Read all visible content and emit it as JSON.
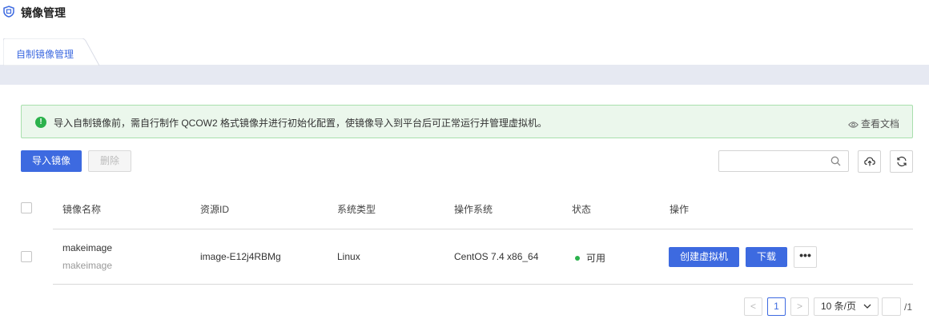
{
  "header": {
    "title": "镜像管理",
    "logo_icon": "shield-icon"
  },
  "tabs": [
    {
      "label": "自制镜像管理",
      "active": true
    }
  ],
  "alert": {
    "text": "导入自制镜像前，需自行制作 QCOW2 格式镜像并进行初始化配置，使镜像导入到平台后可正常运行并管理虚拟机。",
    "link_label": "查看文档",
    "icon": "info-circle-icon",
    "color": "#2bb24c"
  },
  "toolbar": {
    "import_label": "导入镜像",
    "delete_label": "删除",
    "search_placeholder": "",
    "search_value": "",
    "upload_icon": "cloud-upload-icon",
    "refresh_icon": "refresh-icon"
  },
  "table": {
    "columns": [
      "镜像名称",
      "资源ID",
      "系统类型",
      "操作系统",
      "状态",
      "操作"
    ],
    "rows": [
      {
        "name": "makeimage",
        "description": "makeimage",
        "resource_id": "image-E12j4RBMg",
        "system_type": "Linux",
        "os": "CentOS 7.4 x86_64",
        "status": "可用",
        "actions": {
          "create_vm": "创建虚拟机",
          "download": "下载",
          "more": "•••"
        }
      }
    ]
  },
  "pagination": {
    "prev": "<",
    "current_page": "1",
    "next": ">",
    "page_size": "10 条/页",
    "jump_value": "",
    "total_pages": "/1"
  },
  "colors": {
    "primary": "#3d6ae0",
    "success": "#2bb24c",
    "tab_strip": "#e6e9f2"
  }
}
